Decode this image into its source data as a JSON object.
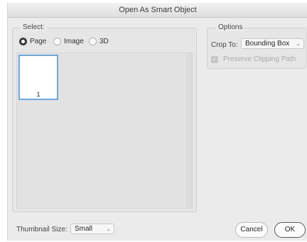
{
  "window": {
    "title": "Open As Smart Object"
  },
  "select_group": {
    "title": "Select:",
    "radios": [
      {
        "label": "Page",
        "checked": true
      },
      {
        "label": "Image",
        "checked": false
      },
      {
        "label": "3D",
        "checked": false
      }
    ],
    "thumbnails": [
      {
        "number": "1",
        "selected": true
      }
    ]
  },
  "thumbnail_size": {
    "label": "Thumbnail Size:",
    "value": "Small"
  },
  "options": {
    "title": "Options",
    "crop_to_label": "Crop To:",
    "crop_to_value": "Bounding Box",
    "preserve_clipping_label": "Preserve Clipping Path",
    "preserve_clipping_checked": true,
    "preserve_clipping_enabled": false
  },
  "buttons": {
    "cancel": "Cancel",
    "ok": "OK"
  },
  "icons": {
    "dropdown": "chevron-down-icon",
    "checkbox": "checkmark-icon"
  }
}
